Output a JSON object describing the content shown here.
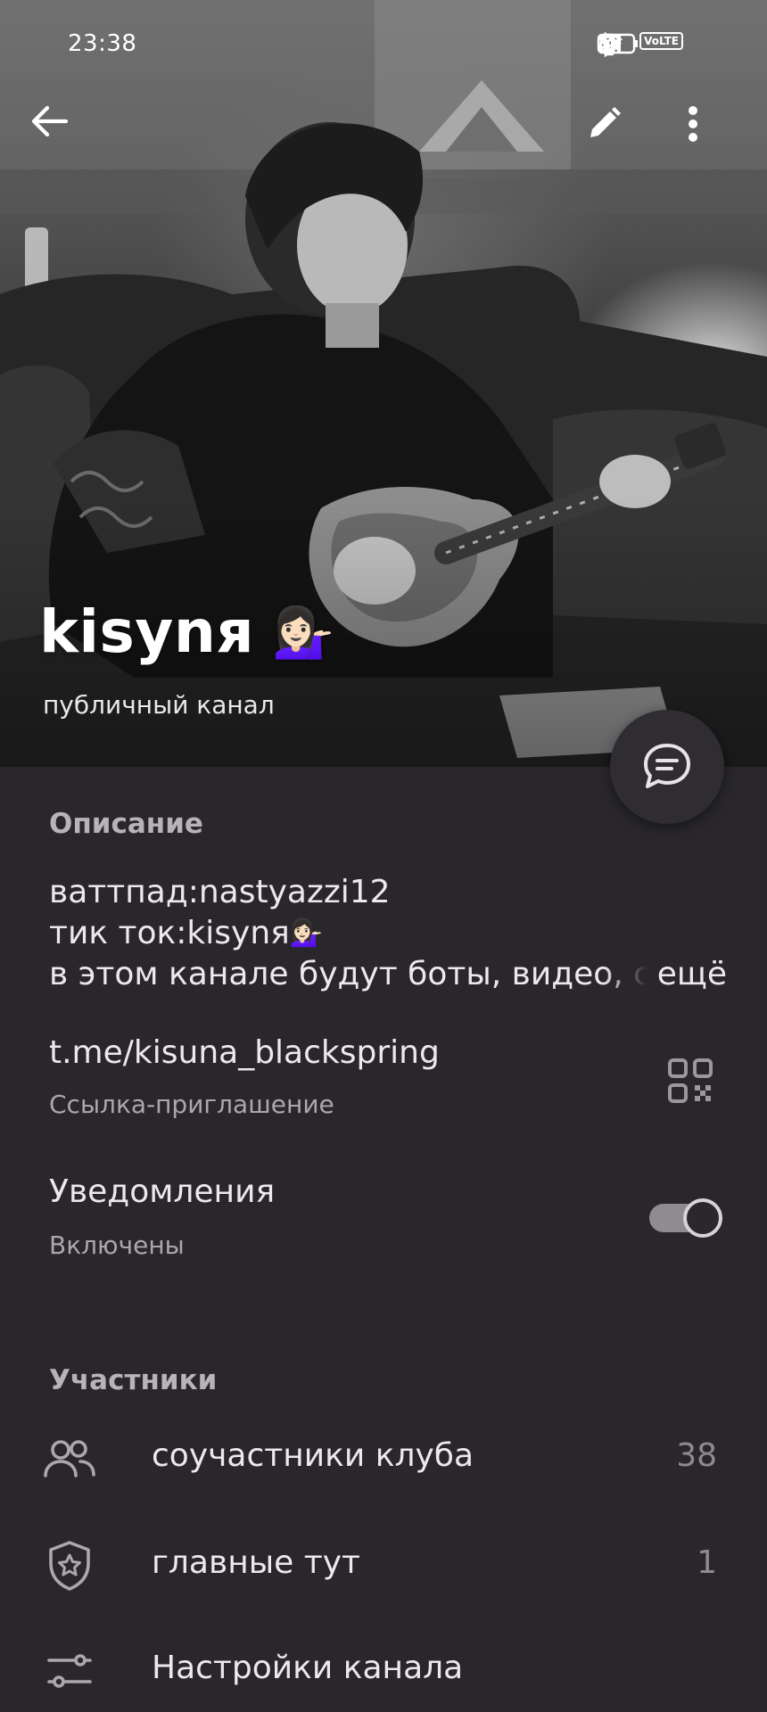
{
  "status_bar": {
    "time": "23:38",
    "volte": "VoLTE",
    "icons": [
      "alarm-icon",
      "bluetooth-icon",
      "vibrate-icon",
      "wifi-icon",
      "signal-icon",
      "battery-charging-icon"
    ]
  },
  "header": {
    "title": "kisynя",
    "title_emoji": "💁🏻‍♀️",
    "subtitle": "публичный канал"
  },
  "description": {
    "section_title": "Описание",
    "line1": "ваттпад:nastyazzi12",
    "line2": "тик ток:kisynя",
    "line2_emoji": "💁🏻‍♀️",
    "line3": "в этом канале будут боты, видео, сп",
    "more": "ещё"
  },
  "invite_link": {
    "url": "t.me/kisuna_blackspring",
    "label": "Ссылка-приглашение"
  },
  "notifications": {
    "title": "Уведомления",
    "status": "Включены",
    "enabled": true
  },
  "members": {
    "section_title": "Участники",
    "items": [
      {
        "label": "соучастники клуба",
        "count": "38",
        "icon": "people-icon"
      },
      {
        "label": "главные тут",
        "count": "1",
        "icon": "admin-shield-icon"
      },
      {
        "label": "Настройки канала",
        "count": "",
        "icon": "settings-sliders-icon"
      }
    ]
  },
  "colors": {
    "background": "#29272b",
    "text": "#ece9ee",
    "muted": "#aaa7ad"
  }
}
